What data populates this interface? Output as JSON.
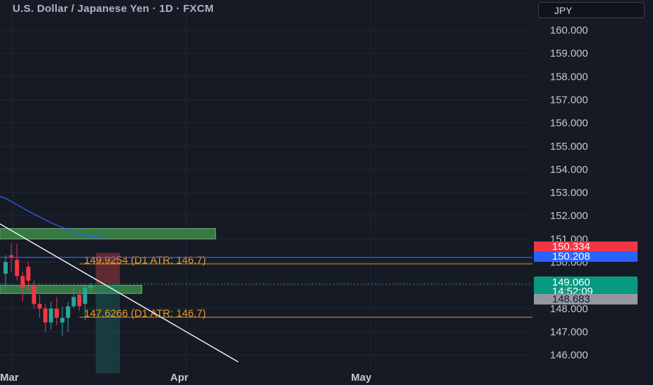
{
  "header": {
    "title": "U.S. Dollar / Japanese Yen · 1D · FXCM",
    "currency_button": "JPY"
  },
  "price_axis": {
    "ticks": [
      "160.000",
      "159.000",
      "158.000",
      "157.000",
      "156.000",
      "155.000",
      "154.000",
      "153.000",
      "152.000",
      "151.000",
      "150.000",
      "148.000",
      "147.000",
      "146.000"
    ]
  },
  "time_axis": {
    "labels": [
      "Mar",
      "Apr",
      "May"
    ]
  },
  "levels": {
    "upper_label": "149.9254 (D1 ATR: 146.7)",
    "lower_label": "147.6266 (D1 ATR: 146.7)"
  },
  "price_tags": {
    "tag1": "150.334",
    "tag2": "150.208",
    "last_price": "149.060",
    "countdown": "14:52:09",
    "tag4": "148.683"
  },
  "colors": {
    "background": "#161a25",
    "bull": "#26a69a",
    "bear": "#f23645",
    "level_orange": "#e79a27",
    "moving_average": "#2962ff",
    "zone_green": "#3e8a4a",
    "trendline": "#ffffff"
  },
  "chart_data": {
    "type": "candlestick",
    "title": "U.S. Dollar / Japanese Yen · 1D · FXCM",
    "ylim": [
      145.3,
      160.5
    ],
    "y_ticks": [
      146,
      147,
      148,
      149,
      150,
      151,
      152,
      153,
      154,
      155,
      156,
      157,
      158,
      159,
      160
    ],
    "x_labels": [
      "Mar",
      "Apr",
      "May"
    ],
    "candles": [
      {
        "o": 149.5,
        "h": 150.3,
        "l": 148.9,
        "c": 150.0
      },
      {
        "o": 150.3,
        "h": 150.8,
        "l": 149.6,
        "c": 150.2
      },
      {
        "o": 150.1,
        "h": 150.8,
        "l": 149.2,
        "c": 149.4
      },
      {
        "o": 149.4,
        "h": 149.6,
        "l": 148.3,
        "c": 148.9
      },
      {
        "o": 149.8,
        "h": 150.0,
        "l": 148.8,
        "c": 149.2
      },
      {
        "o": 149.0,
        "h": 149.2,
        "l": 148.0,
        "c": 148.2
      },
      {
        "o": 148.2,
        "h": 148.6,
        "l": 147.6,
        "c": 148.0
      },
      {
        "o": 148.0,
        "h": 148.2,
        "l": 147.0,
        "c": 147.4
      },
      {
        "o": 147.4,
        "h": 148.3,
        "l": 147.1,
        "c": 148.0
      },
      {
        "o": 148.0,
        "h": 148.5,
        "l": 147.3,
        "c": 147.6
      },
      {
        "o": 147.4,
        "h": 148.1,
        "l": 146.8,
        "c": 147.6
      },
      {
        "o": 147.6,
        "h": 148.3,
        "l": 147.0,
        "c": 148.1
      },
      {
        "o": 148.1,
        "h": 148.9,
        "l": 148.0,
        "c": 148.5
      },
      {
        "o": 148.6,
        "h": 148.8,
        "l": 147.9,
        "c": 148.1
      },
      {
        "o": 148.2,
        "h": 149.0,
        "l": 147.5,
        "c": 148.9
      },
      {
        "o": 148.9,
        "h": 149.1,
        "l": 148.7,
        "c": 149.0
      }
    ],
    "moving_average": [
      {
        "candle": -3,
        "v": 153.0
      },
      {
        "candle": 0,
        "v": 152.75
      },
      {
        "candle": 4,
        "v": 152.2
      },
      {
        "candle": 8,
        "v": 151.7
      },
      {
        "candle": 12,
        "v": 151.3
      },
      {
        "candle": 15,
        "v": 151.1
      },
      {
        "candle": 17,
        "v": 151.1
      }
    ],
    "horizontal_levels": [
      {
        "price": 149.9254,
        "label": "149.9254 (D1 ATR: 146.7)"
      },
      {
        "price": 147.6266,
        "label": "147.6266 (D1 ATR: 146.7)"
      },
      {
        "price": 150.208,
        "kind": "blue-line"
      }
    ],
    "zones": [
      {
        "from": 151.0,
        "to": 151.45,
        "x0": -1,
        "x1": 37
      },
      {
        "from": 148.65,
        "to": 149.0,
        "x0": -1,
        "x1": 24
      }
    ],
    "position": {
      "entry": 149.06,
      "stop": 150.4,
      "target": 145.2,
      "x0": 16,
      "x1": 20
    },
    "trendline": {
      "from": {
        "x": -1,
        "p": 151.65
      },
      "to": {
        "x": 41,
        "p": 145.7
      }
    },
    "last_price": 149.06
  }
}
